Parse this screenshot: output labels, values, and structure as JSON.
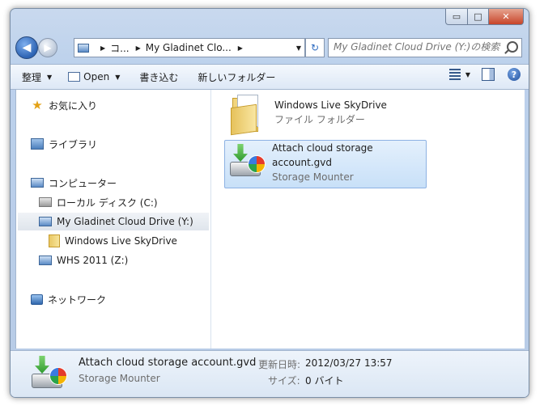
{
  "window_controls": {
    "minimize": "▭",
    "maximize": "□",
    "close": "✕"
  },
  "navigation": {
    "back": "◀",
    "forward": "▶",
    "breadcrumb": [
      "コ...",
      "My Gladinet Clo..."
    ],
    "refresh": "↻",
    "search_placeholder": "My Gladinet Cloud Drive (Y:)の検索"
  },
  "toolbar": {
    "organize": "整理",
    "open": "Open",
    "burn": "書き込む",
    "new_folder": "新しいフォルダー",
    "help": "?"
  },
  "nav_pane": {
    "favorites": "お気に入り",
    "libraries": "ライブラリ",
    "computer": "コンピューター",
    "local_disk": "ローカル ディスク (C:)",
    "cloud_drive": "My Gladinet Cloud Drive (Y:)",
    "skydrive": "Windows Live SkyDrive",
    "whs": "WHS 2011 (Z:)",
    "network": "ネットワーク"
  },
  "files": [
    {
      "name": "Windows Live SkyDrive",
      "sub": "ファイル フォルダー",
      "icon": "folder-icon"
    },
    {
      "name_line1": "Attach cloud storage",
      "name_line2": "account.gvd",
      "sub": "Storage Mounter",
      "icon": "storage-mounter-icon"
    }
  ],
  "details": {
    "name": "Attach cloud storage account.gvd",
    "type": "Storage Mounter",
    "modified_label": "更新日時:",
    "modified_value": "2012/03/27 13:57",
    "size_label": "サイズ:",
    "size_value": "0 バイト"
  }
}
